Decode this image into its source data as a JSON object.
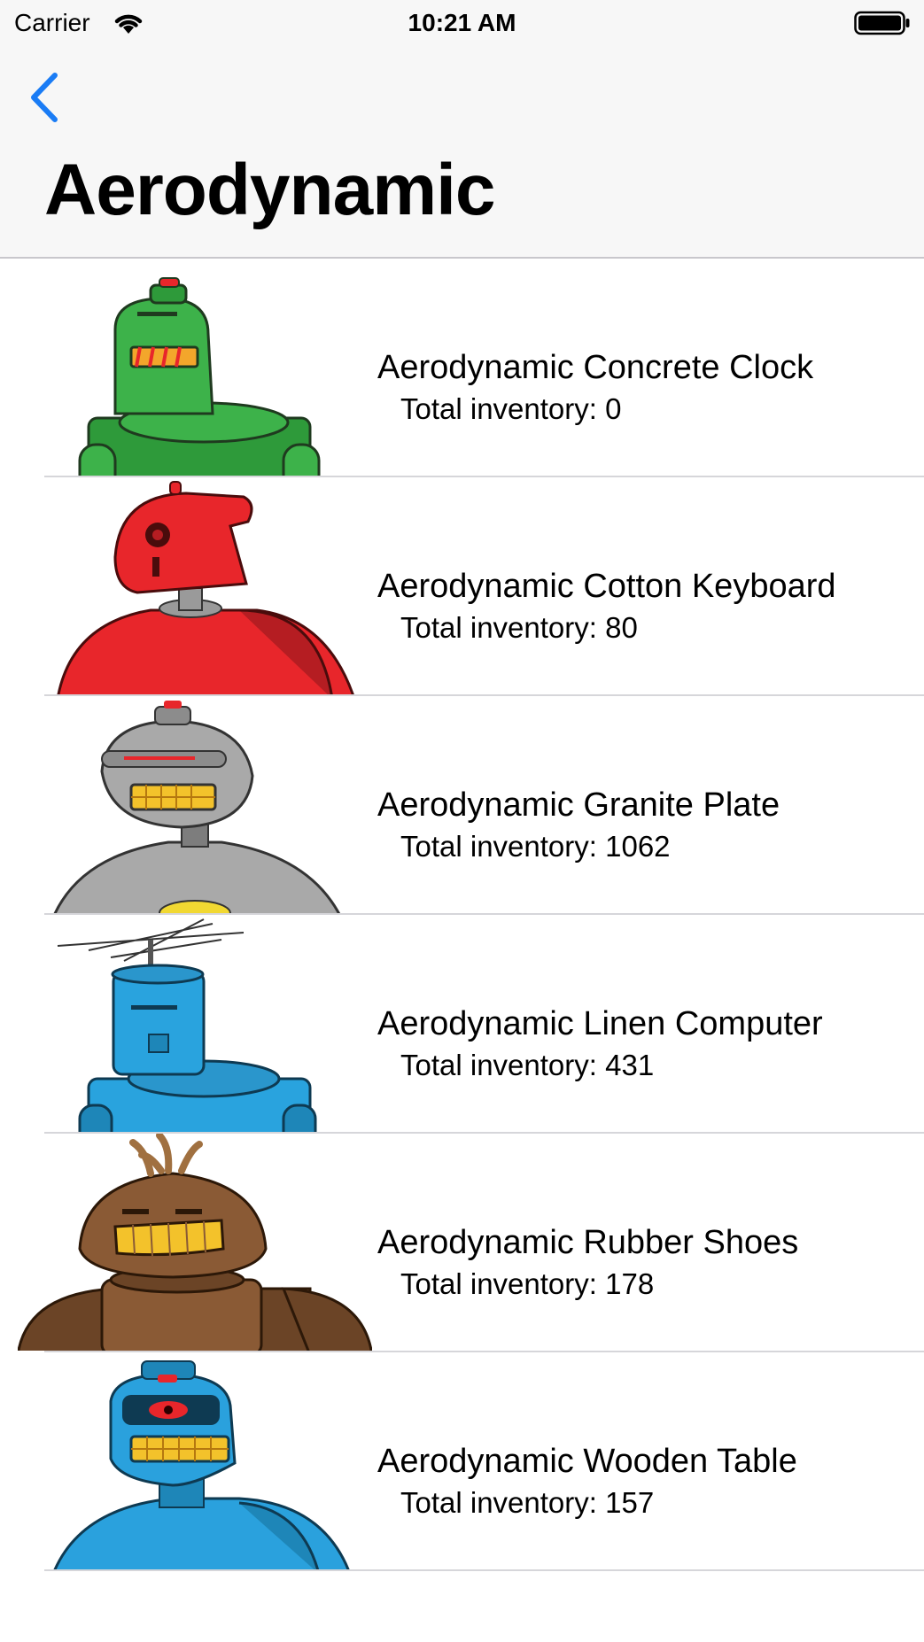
{
  "status_bar": {
    "carrier": "Carrier",
    "time": "10:21 AM"
  },
  "nav": {
    "title": "Aerodynamic",
    "back_icon": "chevron-left-icon",
    "accent_color": "#1a7cf5"
  },
  "items": [
    {
      "title": "Aerodynamic Concrete Clock",
      "inventory": "Total inventory: 0",
      "robot_color": "#3db24a",
      "robot_icon": "green-robot"
    },
    {
      "title": "Aerodynamic Cotton Keyboard",
      "inventory": "Total inventory: 80",
      "robot_color": "#e8262b",
      "robot_icon": "red-robot"
    },
    {
      "title": "Aerodynamic Granite Plate",
      "inventory": "Total inventory: 1062",
      "robot_color": "#a9a9a9",
      "robot_icon": "gray-robot"
    },
    {
      "title": "Aerodynamic Linen Computer",
      "inventory": "Total inventory: 431",
      "robot_color": "#29a3de",
      "robot_icon": "blue-antenna-robot"
    },
    {
      "title": "Aerodynamic Rubber Shoes",
      "inventory": "Total inventory: 178",
      "robot_color": "#8a5a35",
      "robot_icon": "brown-robot"
    },
    {
      "title": "Aerodynamic Wooden Table",
      "inventory": "Total inventory: 157",
      "robot_color": "#2aa1dd",
      "robot_icon": "blue-robot"
    }
  ]
}
